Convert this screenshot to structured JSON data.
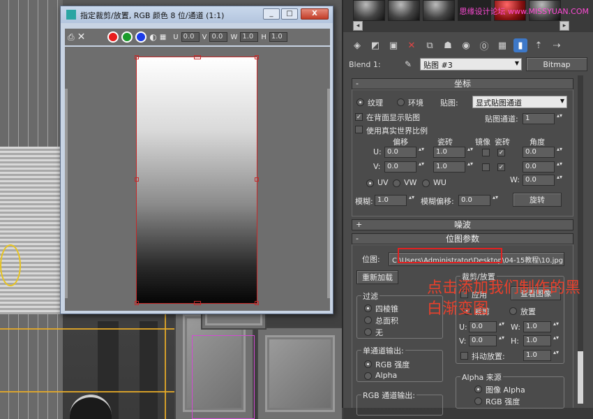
{
  "crop_window": {
    "title": "指定裁剪/放置, RGB 颜色 8 位/通道 (1:1)",
    "controls": {
      "u_label": "U",
      "u_value": "0.0",
      "v_label": "V",
      "v_value": "0.0",
      "w_label": "W",
      "w_value": "1.0",
      "h_label": "H",
      "h_value": "1.0"
    },
    "swatches": [
      "#e81c1c",
      "#1c9c2c",
      "#1c3ce8"
    ],
    "caption_buttons": {
      "minimize": "_",
      "maximize": "□",
      "close": "X"
    }
  },
  "watermark": "思缘设计论坛 www.MISSYUAN.COM",
  "material_editor": {
    "blend_label": "Blend 1:",
    "map_name": "贴图 #3",
    "map_type": "Bitmap",
    "coordinates": {
      "header": "坐标",
      "texture_label": "纹理",
      "environ_label": "环境",
      "mapping_label": "贴图:",
      "mapping_value": "显式贴图通道",
      "show_back_label": "在背面显示贴图",
      "map_channel_label": "贴图通道:",
      "map_channel_value": "1",
      "real_world_label": "使用真实世界比例",
      "offset_label": "偏移",
      "tiling_label": "瓷砖",
      "mirror_label": "镜像",
      "tile_label": "瓷砖",
      "angle_label": "角度",
      "u_label": "U:",
      "v_label": "V:",
      "w_label": "W:",
      "u_offset": "0.0",
      "v_offset": "0.0",
      "u_tiling": "1.0",
      "v_tiling": "1.0",
      "u_angle": "0.0",
      "v_angle": "0.0",
      "w_angle": "0.0",
      "uv_label": "UV",
      "vw_label": "VW",
      "wu_label": "WU",
      "blur_label": "模糊:",
      "blur_value": "1.0",
      "blur_offset_label": "模糊偏移:",
      "blur_offset_value": "0.0",
      "rotate_label": "旋转"
    },
    "noise": {
      "header": "噪波"
    },
    "bitmap_params": {
      "header": "位图参数",
      "bitmap_label": "位图:",
      "bitmap_path": "C:\\Users\\Administrator\\Desktop\\04-15教程\\10.jpg",
      "reload_label": "重新加载",
      "crop_place_title": "裁剪/放置",
      "apply_label": "应用",
      "view_image_label": "查看图像",
      "crop_label": "裁剪",
      "place_label": "放置",
      "u_label": "U:",
      "u_value": "0.0",
      "v_label": "V:",
      "v_value": "0.0",
      "w_label": "W:",
      "w_value": "1.0",
      "h_label": "H:",
      "h_value": "1.0",
      "jitter_label": "抖动放置:",
      "jitter_value": "1.0",
      "filter_title": "过滤",
      "filter_pyramid": "四棱锥",
      "filter_summed": "总面积",
      "filter_none": "无",
      "mono_title": "单通道输出:",
      "mono_rgb": "RGB 强度",
      "mono_alpha": "Alpha",
      "rgb_title": "RGB 通道输出:",
      "alpha_title": "Alpha 来源",
      "alpha_image": "图像 Alpha",
      "alpha_rgb": "RGB 强度"
    }
  },
  "annotation": "点击添加我们制作的黑白渐变图"
}
